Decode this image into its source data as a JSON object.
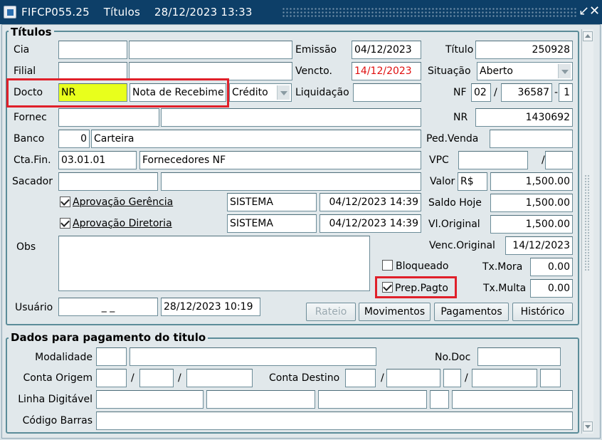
{
  "window": {
    "title": "FIFCP055.25",
    "module": "Títulos",
    "datetime": "28/12/2023 13:33",
    "minimize_icon": "minimize-icon",
    "close_icon": "close-icon"
  },
  "titulos": {
    "group_label": "Títulos",
    "cia": {
      "label": "Cia",
      "code": "",
      "name": ""
    },
    "filial": {
      "label": "Filial",
      "code": "",
      "name": ""
    },
    "docto": {
      "label": "Docto",
      "code": "NR",
      "desc": "Nota de Recebime",
      "type": "Crédito"
    },
    "fornec": {
      "label": "Fornec",
      "code": "",
      "name": ""
    },
    "banco": {
      "label": "Banco",
      "code": "0",
      "name": "Carteira"
    },
    "cta_fin": {
      "label": "Cta.Fin.",
      "code": "03.01.01",
      "name": "Fornecedores NF"
    },
    "sacador": {
      "label": "Sacador",
      "code": "",
      "name": ""
    },
    "aprov_gerencia": {
      "label": "Aprovação Gerência",
      "checked": true,
      "user": "SISTEMA",
      "date": "04/12/2023 14:39"
    },
    "aprov_diretoria": {
      "label": "Aprovação Diretoria",
      "checked": true,
      "user": "SISTEMA",
      "date": "04/12/2023 14:39"
    },
    "obs": {
      "label": "Obs",
      "value": ""
    },
    "usuario": {
      "label": "Usuário",
      "value": "_   _",
      "date": "28/12/2023 10:19"
    },
    "emissao": {
      "label": "Emissão",
      "value": "04/12/2023"
    },
    "vencto": {
      "label": "Vencto.",
      "value": "14/12/2023"
    },
    "liquidacao": {
      "label": "Liquidação",
      "value": ""
    },
    "titulo": {
      "label": "Título",
      "value": "250928"
    },
    "situacao": {
      "label": "Situação",
      "value": "Aberto"
    },
    "nf": {
      "label": "NF",
      "serie": "02",
      "numero": "36587",
      "parcela": "1",
      "sep1": "/",
      "sep2": "-"
    },
    "nr": {
      "label": "NR",
      "value": "1430692"
    },
    "ped_venda": {
      "label": "Ped.Venda",
      "value": ""
    },
    "vpc": {
      "label": "VPC",
      "value1": "",
      "sep": "/",
      "value2": ""
    },
    "valor": {
      "label": "Valor",
      "currency": "R$",
      "value": "1,500.00"
    },
    "saldo_hoje": {
      "label": "Saldo Hoje",
      "value": "1,500.00"
    },
    "vl_original": {
      "label": "Vl.Original",
      "value": "1,500.00"
    },
    "venc_original": {
      "label": "Venc.Original",
      "value": "14/12/2023"
    },
    "bloqueado": {
      "label": "Bloqueado",
      "checked": false
    },
    "prep_pagto": {
      "label": "Prep.Pagto",
      "checked": true
    },
    "tx_mora": {
      "label": "Tx.Mora",
      "value": "0.00"
    },
    "tx_multa": {
      "label": "Tx.Multa",
      "value": "0.00"
    },
    "buttons": {
      "rateio": "Rateio",
      "movimentos": "Movimentos",
      "pagamentos": "Pagamentos",
      "historico": "Histórico"
    }
  },
  "pagamento": {
    "group_label": "Dados para pagamento do titulo",
    "modalidade": "Modalidade",
    "no_doc": "No.Doc",
    "conta_origem": "Conta Origem",
    "conta_destino": "Conta Destino",
    "linha_digitavel": "Linha Digitável",
    "codigo_barras": "Código Barras",
    "sep": "/"
  },
  "colors": {
    "titlebar": "#0d3f68",
    "highlight": "#e0202a",
    "yellow_field": "#e8ff1c",
    "due_date_red": "#e01010"
  }
}
